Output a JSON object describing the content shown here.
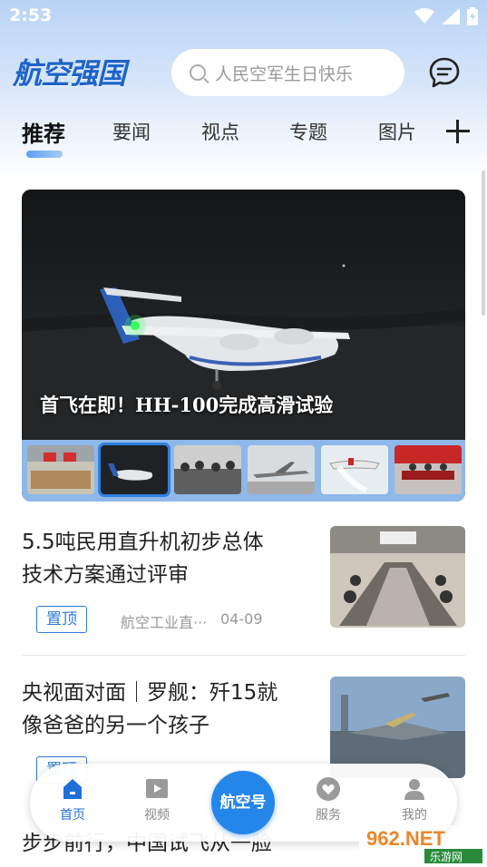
{
  "status_bar": {
    "time": "2:53",
    "icons": [
      "wifi-icon",
      "signal-icon",
      "battery-icon"
    ]
  },
  "header": {
    "logo_text": "航空强国",
    "search_placeholder": "人民空军生日快乐",
    "message_icon": "message-icon"
  },
  "tabs": [
    {
      "label": "推荐",
      "active": true
    },
    {
      "label": "要闻",
      "active": false
    },
    {
      "label": "视点",
      "active": false
    },
    {
      "label": "专题",
      "active": false
    },
    {
      "label": "图片",
      "active": false
    }
  ],
  "banner": {
    "title": "首飞在即！HH-100完成高滑试验",
    "thumbnails": [
      "thumb-hangar",
      "thumb-seaplane",
      "thumb-crowd",
      "thumb-jet",
      "thumb-firefighter",
      "thumb-meeting"
    ],
    "active_index": 1
  },
  "articles": [
    {
      "title_line1": "5.5吨民用直升机初步总体",
      "title_line2": "技术方案通过评审",
      "badge": "置顶",
      "source": "航空工业直···",
      "date": "04-09"
    },
    {
      "title_line1": "央视面对面｜罗舰：歼15就",
      "title_line2": "像爸爸的另一个孩子",
      "badge": "置顶"
    },
    {
      "title_line1": "步步前行，中国试飞从一脸"
    }
  ],
  "bottom_nav": [
    {
      "label": "首页",
      "icon": "home-icon",
      "active": true
    },
    {
      "label": "视频",
      "icon": "video-icon",
      "active": false
    },
    {
      "label": "航空号",
      "icon": "",
      "active": false
    },
    {
      "label": "服务",
      "icon": "heart-icon",
      "active": false
    },
    {
      "label": "我的",
      "icon": "user-icon",
      "active": false
    }
  ],
  "watermark": {
    "text": "962.NET",
    "subtext": "乐游网"
  },
  "colors": {
    "accent": "#2586ea",
    "header_gradient_top": "#b9d3f5",
    "thumb_strip": "#8eb8ea"
  }
}
